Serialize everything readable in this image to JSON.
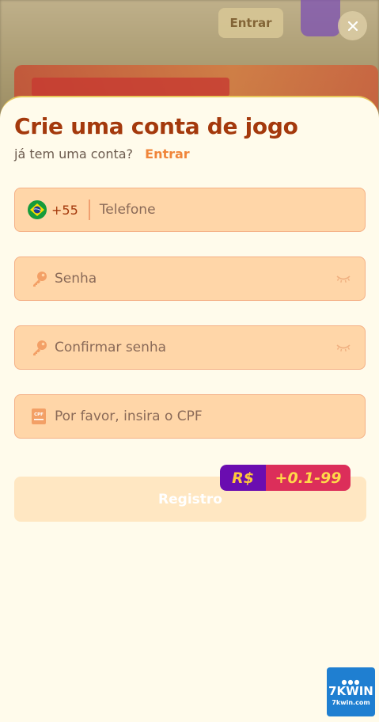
{
  "background": {
    "enter_label": "Entrar"
  },
  "modal": {
    "title": "Crie uma conta de jogo",
    "subtitle": "já tem uma conta?",
    "login_link": "Entrar"
  },
  "phone": {
    "country_code": "+55",
    "placeholder": "Telefone"
  },
  "password": {
    "placeholder": "Senha"
  },
  "confirm_password": {
    "placeholder": "Confirmar senha"
  },
  "cpf": {
    "placeholder": "Por favor, insira o CPF",
    "icon_label": "CPF"
  },
  "register": {
    "label": "Registro",
    "bonus_currency": "R$",
    "bonus_amount": "+0.1-99"
  },
  "brand": {
    "name": "7KWIN",
    "url": "7kwin.com"
  },
  "colors": {
    "title": "#a4390c",
    "accent": "#f0853a",
    "field_bg": "#ffd6a8",
    "register_bg": "#ffe7c2",
    "bonus_currency_bg": "#6a0db0",
    "bonus_amount_bg": "#dc2e5a"
  },
  "icons": {
    "close": "close-icon",
    "flag": "brazil-flag-icon",
    "key": "key-icon",
    "eye": "eye-closed-icon",
    "cpf": "cpf-card-icon"
  }
}
